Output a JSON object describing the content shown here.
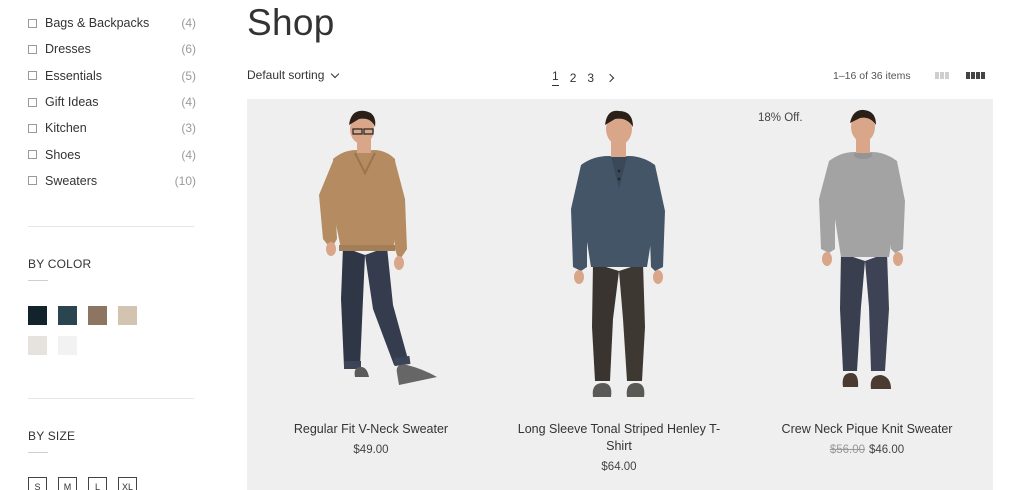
{
  "categories": [
    {
      "label": "Bags & Backpacks",
      "count": "(4)"
    },
    {
      "label": "Dresses",
      "count": "(6)"
    },
    {
      "label": "Essentials",
      "count": "(5)"
    },
    {
      "label": "Gift Ideas",
      "count": "(4)"
    },
    {
      "label": "Kitchen",
      "count": "(3)"
    },
    {
      "label": "Shoes",
      "count": "(4)"
    },
    {
      "label": "Sweaters",
      "count": "(10)"
    }
  ],
  "color_filter": {
    "title": "BY COLOR",
    "swatches": [
      "#13232b",
      "#2b4550",
      "#8c7662",
      "#d3c3b1",
      "#e6e2de",
      "#f2f2f2"
    ]
  },
  "size_filter": {
    "title": "BY SIZE",
    "sizes": [
      "S",
      "M",
      "L",
      "XL"
    ]
  },
  "page": {
    "title": "Shop",
    "sorting_label": "Default sorting",
    "pages": [
      "1",
      "2",
      "3"
    ],
    "current_page": "1",
    "result_count": "1–16 of 36 items"
  },
  "products": [
    {
      "name": "Regular Fit V-Neck Sweater",
      "price": "$49.00",
      "old_price": "",
      "badge": ""
    },
    {
      "name": "Long Sleeve Tonal Striped Henley T-Shirt",
      "price": "$64.00",
      "old_price": "",
      "badge": ""
    },
    {
      "name": "Crew Neck Pique Knit Sweater",
      "price": "$46.00",
      "old_price": "$56.00",
      "badge": "18% Off."
    }
  ],
  "icons": {
    "sort": "chevron-down-icon",
    "next": "chevron-right-icon",
    "grid_small": "grid-3-icon",
    "grid_large": "grid-4-icon"
  }
}
